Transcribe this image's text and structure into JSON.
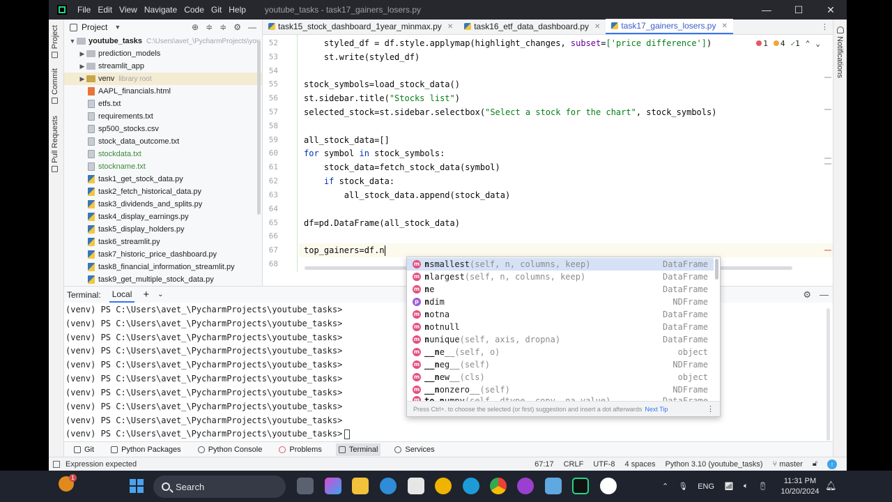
{
  "window": {
    "menu": [
      "File",
      "Edit",
      "View",
      "Navigate",
      "Code",
      "Git",
      "Help"
    ],
    "title": "youtube_tasks - task17_gainers_losers.py",
    "min": "—",
    "max": "☐",
    "close": "✕"
  },
  "left_strip": {
    "project": "Project",
    "commit": "Commit",
    "pull_requests": "Pull Requests"
  },
  "right_strip": {
    "notifications": "Notifications"
  },
  "project": {
    "header": "Project",
    "root": {
      "name": "youtube_tasks",
      "path": "C:\\Users\\avet_\\PycharmProjects\\you"
    },
    "items": [
      {
        "label": "prediction_models",
        "extra": ""
      },
      {
        "label": "streamlit_app",
        "extra": ""
      },
      {
        "label": "venv",
        "extra": "library root"
      },
      {
        "label": "AAPL_financials.html"
      },
      {
        "label": "etfs.txt"
      },
      {
        "label": "requirements.txt"
      },
      {
        "label": "sp500_stocks.csv"
      },
      {
        "label": "stock_data_outcome.txt"
      },
      {
        "label": "stockdata.txt"
      },
      {
        "label": "stockname.txt"
      },
      {
        "label": "task1_get_stock_data.py"
      },
      {
        "label": "task2_fetch_historical_data.py"
      },
      {
        "label": "task3_dividends_and_splits.py"
      },
      {
        "label": "task4_display_earnings.py"
      },
      {
        "label": "task5_display_holders.py"
      },
      {
        "label": "task6_streamlit.py"
      },
      {
        "label": "task7_historic_price_dashboard.py"
      },
      {
        "label": "task8_financial_information_streamlit.py"
      },
      {
        "label": "task9_get_multiple_stock_data.py"
      }
    ]
  },
  "tabs": [
    {
      "label": "task15_stock_dashboard_1year_minmax.py"
    },
    {
      "label": "task16_etf_data_dashboard.py"
    },
    {
      "label": "task17_gainers_losers.py"
    }
  ],
  "inspections": {
    "errors": "1",
    "warnings": "4",
    "ok": "1"
  },
  "editor": {
    "line_numbers": [
      "52",
      "53",
      "54",
      "55",
      "56",
      "57",
      "58",
      "59",
      "60",
      "61",
      "62",
      "63",
      "64",
      "65",
      "66",
      "67",
      "68"
    ],
    "lines": {
      "l52a": "    styled_df = df.style.applymap(highlight_changes, ",
      "l52b": "subset",
      "l52c": "=",
      "l52d": "['price difference']",
      "l52e": ")",
      "l53": "    st.write(styled_df)",
      "l55": "stock_symbols=load_stock_data()",
      "l56a": "st.sidebar.title(",
      "l56b": "\"Stocks list\"",
      "l56c": ")",
      "l57a": "selected_stock=st.sidebar.selectbox(",
      "l57b": "\"Select a stock for the chart\"",
      "l57c": ", stock_symbols)",
      "l59": "all_stock_data=[]",
      "l60a": "for",
      "l60b": " symbol ",
      "l60c": "in",
      "l60d": " stock_symbols:",
      "l61": "    stock_data=fetch_stock_data(symbol)",
      "l62a": "    ",
      "l62b": "if",
      "l62c": " stock_data:",
      "l63": "        all_stock_data.append(stock_data)",
      "l65": "df=pd.DataFrame(all_stock_data)",
      "l67": "top_gainers=df.n"
    }
  },
  "completion": {
    "items": [
      {
        "badge": "m",
        "bold": "n",
        "rest": "smallest",
        "sig": "(self, n, columns, keep)",
        "type": "DataFrame"
      },
      {
        "badge": "m",
        "bold": "n",
        "rest": "largest",
        "sig": "(self, n, columns, keep)",
        "type": "DataFrame"
      },
      {
        "badge": "m",
        "bold": "n",
        "rest": "e",
        "sig": "",
        "type": "DataFrame"
      },
      {
        "badge": "p",
        "bold": "n",
        "rest": "dim",
        "sig": "",
        "type": "NDFrame"
      },
      {
        "badge": "m",
        "bold": "n",
        "rest": "otna",
        "sig": "",
        "type": "DataFrame"
      },
      {
        "badge": "m",
        "bold": "n",
        "rest": "otnull",
        "sig": "",
        "type": "DataFrame"
      },
      {
        "badge": "m",
        "bold": "n",
        "rest": "unique",
        "sig": "(self, axis, dropna)",
        "type": "DataFrame"
      },
      {
        "badge": "m",
        "bold": "__n",
        "rest": "e__",
        "sig": "(self, o)",
        "type": "object"
      },
      {
        "badge": "m",
        "bold": "__n",
        "rest": "eg__",
        "sig": "(self)",
        "type": "NDFrame"
      },
      {
        "badge": "m",
        "bold": "__n",
        "rest": "ew__",
        "sig": "(cls)",
        "type": "object"
      },
      {
        "badge": "m",
        "bold": "__n",
        "rest": "onzero__",
        "sig": "(self)",
        "type": "NDFrame"
      },
      {
        "badge": "m",
        "bold": "to_n",
        "rest": "umpy",
        "sig": "(self, dtype, copy, na_value)",
        "type": "DataFrame"
      }
    ],
    "footer": "Press Ctrl+. to choose the selected (or first) suggestion and insert a dot afterwards",
    "tip": "Next Tip"
  },
  "terminal": {
    "title": "Terminal:",
    "tab": "Local",
    "prompt": "(venv) PS C:\\Users\\avet_\\PycharmProjects\\youtube_tasks>",
    "line_count": 10
  },
  "bottom_tabs": [
    "Git",
    "Python Packages",
    "Python Console",
    "Problems",
    "Terminal",
    "Services"
  ],
  "status": {
    "message": "Expression expected",
    "position": "67:17",
    "line_sep": "CRLF",
    "encoding": "UTF-8",
    "indent": "4 spaces",
    "interpreter": "Python 3.10 (youtube_tasks)",
    "branch": "master"
  },
  "taskbar": {
    "weather_badge": "1",
    "search": "Search",
    "lang": "ENG",
    "time": "11:31 PM",
    "date": "10/20/2024"
  },
  "colors": {
    "accent": "#3574f0",
    "titlebar": "#27282e",
    "taskbar": "#1f232d"
  }
}
